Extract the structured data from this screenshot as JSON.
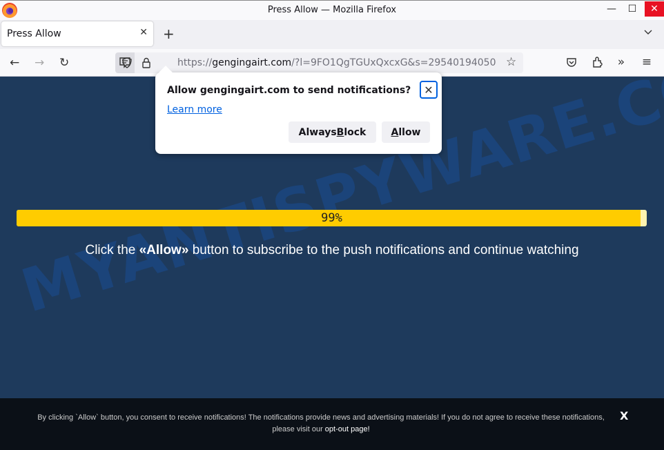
{
  "window": {
    "title": "Press Allow — Mozilla Firefox",
    "minimize_glyph": "—",
    "maximize_glyph": "☐",
    "close_glyph": "✕"
  },
  "tabs": [
    {
      "label": "Press Allow",
      "active": true
    }
  ],
  "tabbar": {
    "new_tab_glyph": "+",
    "list_glyph": "⌄"
  },
  "navbar": {
    "back_glyph": "←",
    "forward_glyph": "→",
    "reload_glyph": "↻",
    "url_scheme": "https://",
    "url_host": "gengingairt.com",
    "url_rest": "/?l=9FO1QgTGUxQxcxG&s=29540194050",
    "bookmark_glyph": "☆",
    "pocket_icon": "pocket-icon",
    "extensions_icon": "puzzle-icon",
    "overflow_glyph": "»",
    "menu_glyph": "≡"
  },
  "popup": {
    "title": "Allow gengingairt.com to send notifications?",
    "learn_more": "Learn more",
    "close_glyph": "✕",
    "block_label_pre": "Always ",
    "block_label_key": "B",
    "block_label_post": "lock",
    "allow_label_key": "A",
    "allow_label_post": "llow"
  },
  "page": {
    "watermark": "MYANTISPYWARE.COM",
    "progress_percent": 99,
    "progress_label": "99%",
    "message_pre": "Click the ",
    "message_bold": "«Allow»",
    "message_post": " button to subscribe to the push notifications and continue watching"
  },
  "footer": {
    "text": "By clicking `Allow` button, you consent to receive notifications! The notifications provide news and advertising materials! If you do not agree to receive these notifications, please visit our ",
    "link": "opt-out page!",
    "close_glyph": "X"
  },
  "colors": {
    "page_bg": "#1e3a5c",
    "progress_fill": "#ffcc00",
    "footer_bg": "#0b1017",
    "close_red": "#e81123",
    "link_blue": "#0061e0"
  }
}
